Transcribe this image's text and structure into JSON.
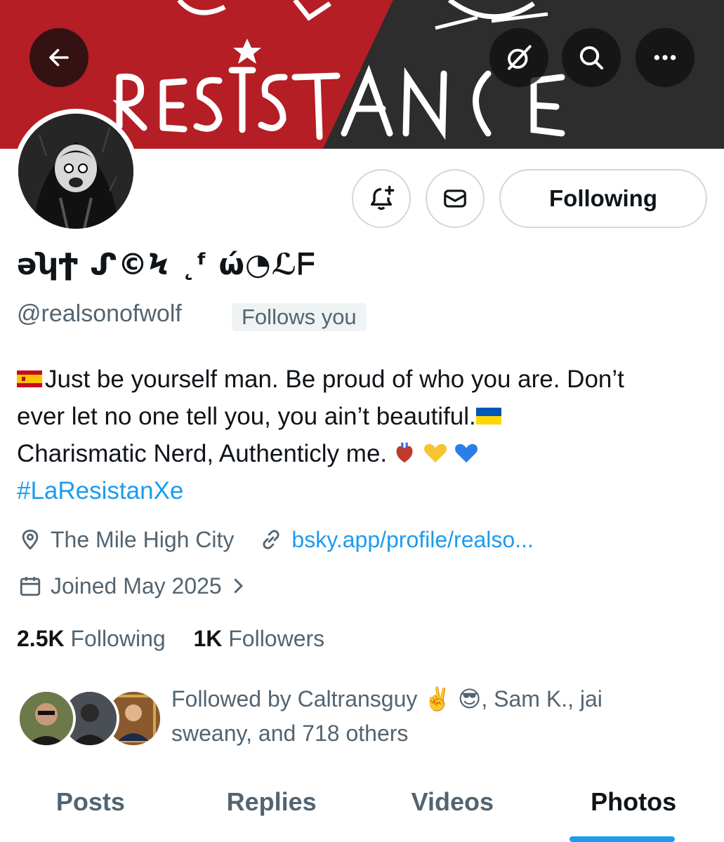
{
  "banner": {
    "text": "RESISTANCE",
    "left_color": "#b41e24",
    "right_color": "#2d2d2d"
  },
  "header": {
    "back_icon": "arrow-left-icon",
    "grok_icon": "grok-icon",
    "search_icon": "search-icon",
    "more_icon": "more-icon"
  },
  "profile": {
    "display_name": "ǝʮϮ ᔑ©Ϟ ˛ᶠ ώ◔ℒᖴ",
    "handle": "@realsonofwolf",
    "follows_you": "Follows you",
    "following_button": "Following",
    "bio_lines": [
      "Just be yourself man. Be proud of who you are. Don’t",
      "ever let no one tell you, you ain’t beautiful.",
      "Charismatic Nerd, Authenticly me."
    ],
    "hashtag": "#LaResistanXe",
    "location": "The Mile High City",
    "link": "bsky.app/profile/realso...",
    "joined": "Joined May 2025"
  },
  "stats": {
    "following_count": "2.5K",
    "following_label": "Following",
    "followers_count": "1K",
    "followers_label": "Followers"
  },
  "followed_by": {
    "line1": "Followed by Caltransguy ✌️ 😎, Sam K., jai",
    "line2": "sweany, and 718 others"
  },
  "tabs": [
    {
      "label": "Posts"
    },
    {
      "label": "Replies"
    },
    {
      "label": "Videos"
    },
    {
      "label": "Photos"
    }
  ],
  "active_tab": "Photos",
  "colors": {
    "accent": "#1d9bf0",
    "secondary_text": "#536471",
    "primary_text": "#0f1419",
    "border": "#cfd9de"
  }
}
